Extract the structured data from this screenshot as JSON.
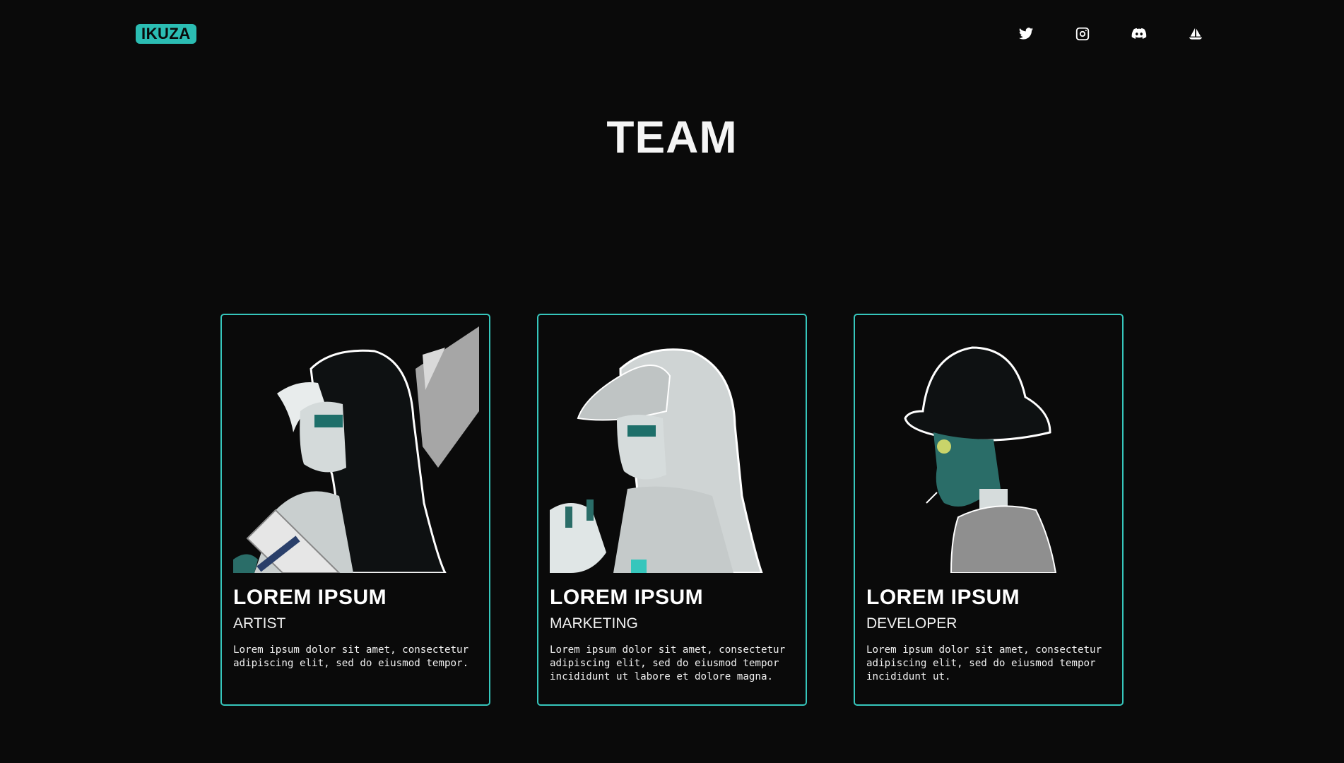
{
  "header": {
    "logo_text": "IKUZA",
    "social_icons": [
      "twitter-icon",
      "instagram-icon",
      "discord-icon",
      "opensea-icon"
    ]
  },
  "page": {
    "title": "TEAM"
  },
  "team": [
    {
      "name": "LOREM IPSUM",
      "role": "ARTIST",
      "description": "Lorem ipsum dolor sit amet, consectetur adipiscing elit, sed do eiusmod tempor."
    },
    {
      "name": "LOREM IPSUM",
      "role": "MARKETING",
      "description": "Lorem ipsum dolor sit amet, consectetur adipiscing elit, sed do eiusmod tempor incididunt ut labore et dolore magna."
    },
    {
      "name": "LOREM IPSUM",
      "role": "DEVELOPER",
      "description": "Lorem ipsum dolor sit amet, consectetur adipiscing elit, sed do eiusmod tempor incididunt ut."
    }
  ],
  "colors": {
    "background": "#0a0a0a",
    "accent": "#2bbdb3",
    "text": "#ffffff"
  }
}
